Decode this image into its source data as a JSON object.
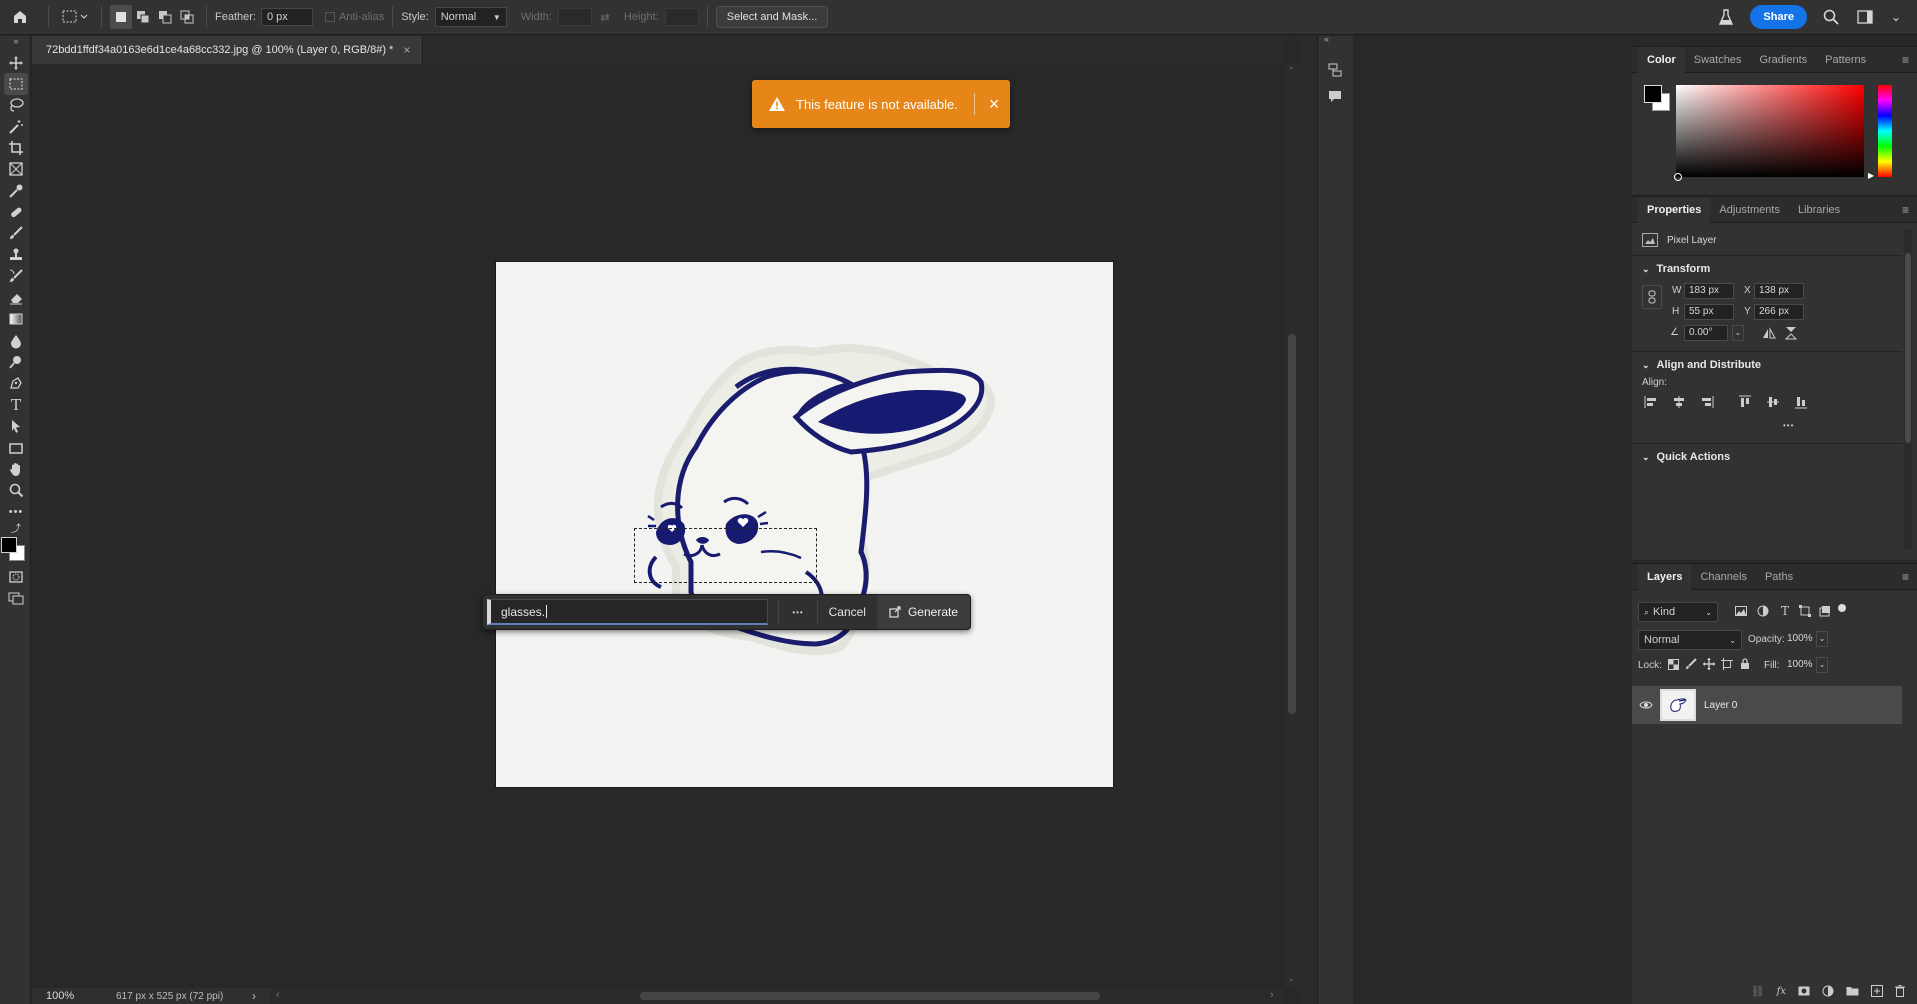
{
  "options_bar": {
    "feather_label": "Feather:",
    "feather_value": "0 px",
    "antialias_label": "Anti-alias",
    "style_label": "Style:",
    "style_value": "Normal",
    "width_label": "Width:",
    "height_label": "Height:",
    "select_mask_label": "Select and Mask...",
    "share_label": "Share"
  },
  "document": {
    "tab_title": "72bdd1ffdf34a0163e6d1ce4a68cc332.jpg @ 100% (Layer 0, RGB/8#) *",
    "close_glyph": "×"
  },
  "status": {
    "zoom": "100%",
    "doc_info": "617 px x 525 px (72 ppi)",
    "arrow": "›"
  },
  "toast": {
    "message": "This feature is not available.",
    "close_glyph": "×"
  },
  "gen_bar": {
    "prompt_value": "glasses.",
    "more_glyph": "•••",
    "cancel_label": "Cancel",
    "generate_label": "Generate"
  },
  "color_panel": {
    "tabs": [
      "Color",
      "Swatches",
      "Gradients",
      "Patterns"
    ],
    "foreground": "#000000",
    "background": "#ffffff",
    "hue_color": "#ff0000"
  },
  "properties_panel": {
    "tabs": [
      "Properties",
      "Adjustments",
      "Libraries"
    ],
    "layer_kind": "Pixel Layer",
    "transform_title": "Transform",
    "w_label": "W",
    "w_value": "183 px",
    "h_label": "H",
    "h_value": "55 px",
    "x_label": "X",
    "x_value": "138 px",
    "y_label": "Y",
    "y_value": "266 px",
    "angle_value": "0.00°",
    "align_title": "Align and Distribute",
    "align_label": "Align:",
    "more_glyph": "•••",
    "quick_actions_title": "Quick Actions"
  },
  "layers_panel": {
    "tabs": [
      "Layers",
      "Channels",
      "Paths"
    ],
    "filter_kind": "Kind",
    "blend_mode": "Normal",
    "opacity_label": "Opacity:",
    "opacity_value": "100%",
    "lock_label": "Lock:",
    "fill_label": "Fill:",
    "fill_value": "100%",
    "layers": [
      {
        "name": "Layer 0",
        "visible": true,
        "selected": true
      }
    ]
  }
}
